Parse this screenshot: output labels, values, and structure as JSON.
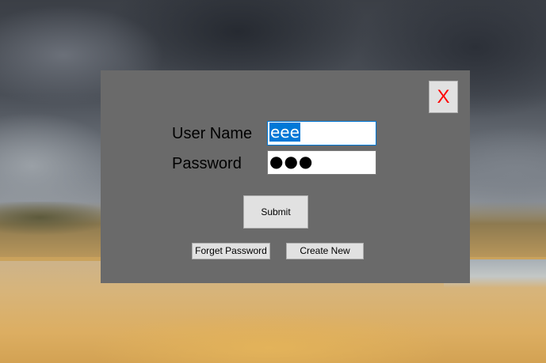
{
  "dialog": {
    "close_label": "X",
    "username_label": "User Name",
    "password_label": "Password",
    "username_value": "eee",
    "password_value": "●●●",
    "submit_label": "Submit",
    "forgot_label": "Forget Password",
    "create_label": "Create New"
  },
  "colors": {
    "dialog_bg": "#6a6a6a",
    "button_bg": "#e1e1e1",
    "close_text": "#ff0000",
    "selection": "#0078d7"
  },
  "icons": {
    "close": "close-icon"
  }
}
